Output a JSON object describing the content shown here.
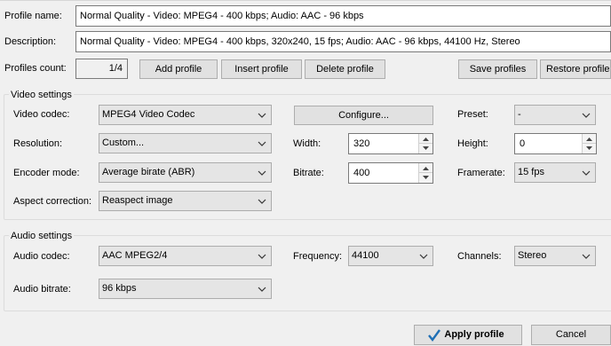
{
  "profile": {
    "name_label": "Profile name:",
    "name_value": "Normal Quality - Video: MPEG4 - 400 kbps; Audio: AAC - 96 kbps",
    "description_label": "Description:",
    "description_value": "Normal Quality - Video: MPEG4 - 400 kbps, 320x240, 15 fps; Audio: AAC - 96 kbps, 44100 Hz, Stereo",
    "count_label": "Profiles count:",
    "count_value": "1/4"
  },
  "toolbar": {
    "add_profile": "Add profile",
    "insert_profile": "Insert profile",
    "delete_profile": "Delete profile",
    "save_profiles": "Save profiles",
    "restore_profiles": "Restore profiles"
  },
  "video": {
    "group_title": "Video settings",
    "codec_label": "Video codec:",
    "codec_value": "MPEG4 Video Codec",
    "configure_button": "Configure...",
    "preset_label": "Preset:",
    "preset_value": "-",
    "resolution_label": "Resolution:",
    "resolution_value": "Custom...",
    "width_label": "Width:",
    "width_value": "320",
    "height_label": "Height:",
    "height_value": "0",
    "encoder_label": "Encoder mode:",
    "encoder_value": "Average birate (ABR)",
    "bitrate_label": "Bitrate:",
    "bitrate_value": "400",
    "framerate_label": "Framerate:",
    "framerate_value": "15 fps",
    "aspect_label": "Aspect correction:",
    "aspect_value": "Reaspect image"
  },
  "audio": {
    "group_title": "Audio settings",
    "codec_label": "Audio codec:",
    "codec_value": "AAC MPEG2/4",
    "frequency_label": "Frequency:",
    "frequency_value": "44100",
    "channels_label": "Channels:",
    "channels_value": "Stereo",
    "bitrate_label": "Audio bitrate:",
    "bitrate_value": "96 kbps"
  },
  "footer": {
    "apply_button": "Apply profile",
    "cancel_button": "Cancel"
  },
  "colors": {
    "window_bg": "#f0f0f0",
    "checkmark": "#1e6fb5"
  }
}
